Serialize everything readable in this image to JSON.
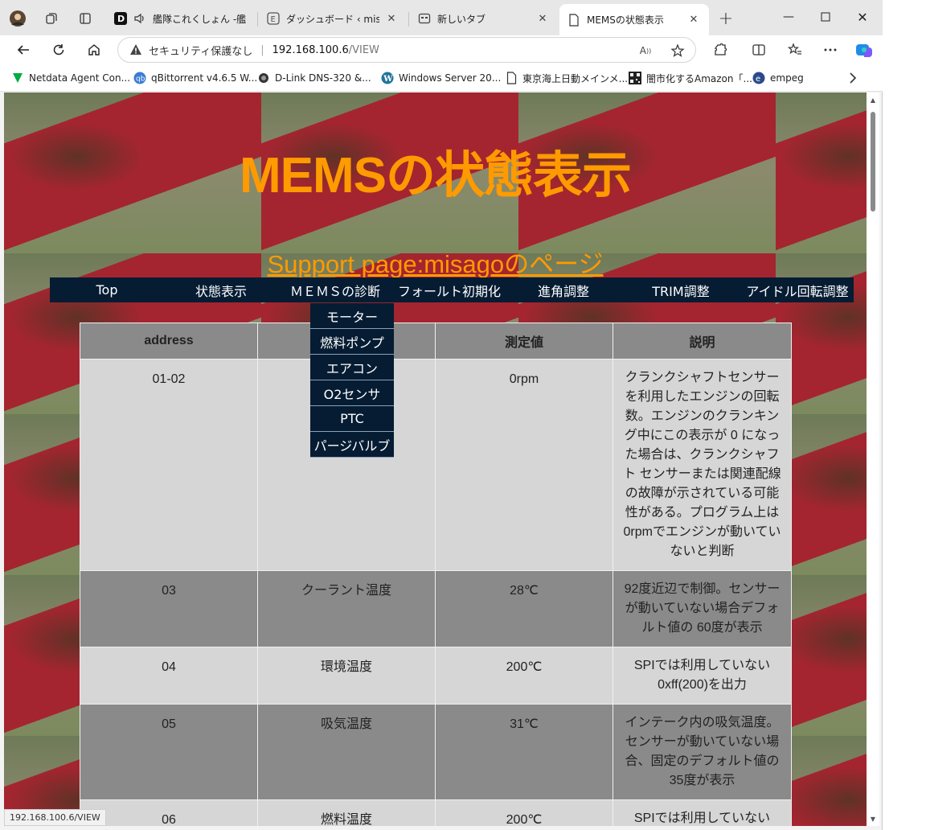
{
  "browser": {
    "tabs": [
      {
        "title": "艦隊これくしょん -艦これ",
        "icon": "speaker-icon",
        "favicon": "D"
      },
      {
        "title": "ダッシュボード ‹ misagoのページ",
        "icon": "e-icon"
      },
      {
        "title": "新しいタブ",
        "icon": "newtab-icon"
      },
      {
        "title": "MEMSの状態表示",
        "icon": "page-icon",
        "active": true
      }
    ],
    "security_label": "セキュリティ保護なし",
    "url_host": "192.168.100.6",
    "url_path": "/VIEW",
    "bookmarks": [
      {
        "label": "Netdata Agent Con...",
        "icon": "netdata-icon"
      },
      {
        "label": "qBittorrent v4.6.5 W...",
        "icon": "qbittorrent-icon"
      },
      {
        "label": "D-Link DNS-320 &...",
        "icon": "dlink-icon"
      },
      {
        "label": "Windows Server 20...",
        "icon": "wordpress-icon"
      },
      {
        "label": "東京海上日動メインメ...",
        "icon": "page-icon"
      },
      {
        "label": "闇市化するAmazon「...",
        "icon": "qr-icon"
      },
      {
        "label": "empeg",
        "icon": "empeg-icon"
      }
    ],
    "status_url": "192.168.100.6/VIEW"
  },
  "page": {
    "title": "MEMSの状態表示",
    "support_link": "Support page:misagoのページ",
    "menu": [
      "Top",
      "状態表示",
      "ＭＥＭＳの診断",
      "フォールト初期化",
      "進角調整",
      "TRIM調整",
      "アイドル回転調整"
    ],
    "dropdown": [
      "モーター",
      "燃料ポンプ",
      "エアコン",
      "O2センサ",
      "PTC",
      "パージバルブ"
    ],
    "table": {
      "headers": [
        "address",
        "",
        "測定値",
        "説明"
      ],
      "rows": [
        {
          "address": "01-02",
          "name": "エ",
          "value": "0rpm",
          "desc": "クランクシャフトセンサーを利用したエンジンの回転数。エンジンのクランキング中にこの表示が 0 になった場合は、クランクシャフト センサーまたは関連配線の故障が示されている可能性がある。プログラム上は0rpmでエンジンが動いていないと判断"
        },
        {
          "address": "03",
          "name": "クーラント温度",
          "value": "28℃",
          "desc": "92度近辺で制御。センサーが動いていない場合デフォルト値の 60度が表示"
        },
        {
          "address": "04",
          "name": "環境温度",
          "value": "200℃",
          "desc": "SPIでは利用していない0xff(200)を出力"
        },
        {
          "address": "05",
          "name": "吸気温度",
          "value": "31℃",
          "desc": "インテーク内の吸気温度。センサーが動いていない場合、固定のデフォルト値の35度が表示"
        },
        {
          "address": "06",
          "name": "燃料温度",
          "value": "200℃",
          "desc": "SPIでは利用していない"
        }
      ]
    }
  }
}
